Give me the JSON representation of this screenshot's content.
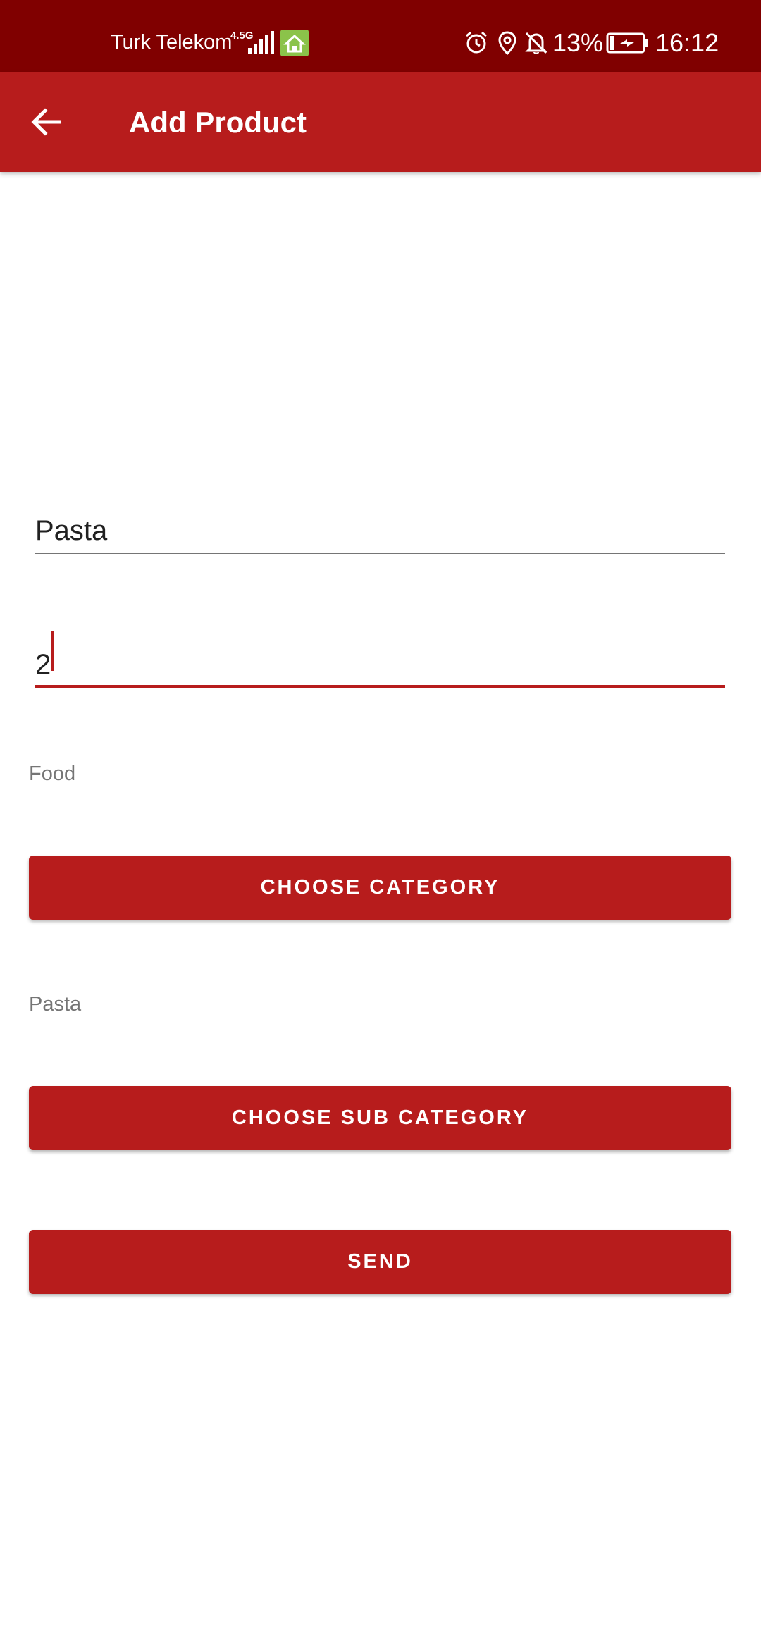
{
  "status_bar": {
    "carrier": "Turk Telekom",
    "network_type": "4.5G",
    "battery_percent": "13%",
    "time": "16:12",
    "icons": [
      "signal-icon",
      "wifi-home-icon",
      "alarm-icon",
      "location-icon",
      "notifications-off-icon",
      "battery-charging-icon"
    ]
  },
  "app_bar": {
    "title": "Add Product",
    "back_icon": "arrow-back-icon"
  },
  "form": {
    "product_name_value": "Pasta",
    "price_value": "2",
    "category_value": "Food",
    "subcategory_value": "Pasta",
    "choose_category_label": "CHOOSE CATEGORY",
    "choose_subcategory_label": "CHOOSE SUB CATEGORY",
    "send_label": "SEND"
  },
  "colors": {
    "status_bar": "#800000",
    "primary": "#b71c1c",
    "hint_text": "#757575"
  }
}
